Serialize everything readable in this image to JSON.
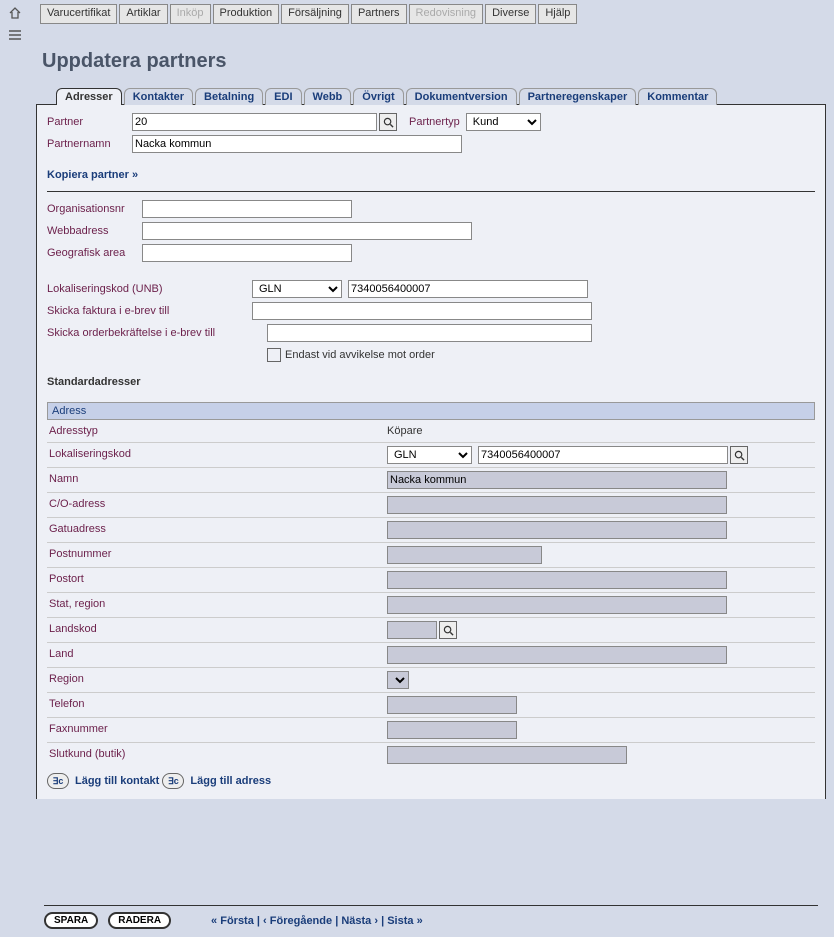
{
  "top_tabs": [
    {
      "label": "Varucertifikat",
      "disabled": false
    },
    {
      "label": "Artiklar",
      "disabled": false
    },
    {
      "label": "Inköp",
      "disabled": true
    },
    {
      "label": "Produktion",
      "disabled": false
    },
    {
      "label": "Försäljning",
      "disabled": false
    },
    {
      "label": "Partners",
      "disabled": false
    },
    {
      "label": "Redovisning",
      "disabled": true
    },
    {
      "label": "Diverse",
      "disabled": false
    },
    {
      "label": "Hjälp",
      "disabled": false
    }
  ],
  "page_title": "Uppdatera partners",
  "sub_tabs": [
    "Adresser",
    "Kontakter",
    "Betalning",
    "EDI",
    "Webb",
    "Övrigt",
    "Dokumentversion",
    "Partneregenskaper",
    "Kommentar"
  ],
  "active_sub_tab": 0,
  "header": {
    "partner_label": "Partner",
    "partner_value": "20",
    "partnertyp_label": "Partnertyp",
    "partnertyp_value": "Kund",
    "partnernamn_label": "Partnernamn",
    "partnernamn_value": "Nacka kommun",
    "kopiera_link": "Kopiera partner »"
  },
  "org_block": {
    "organisationsnr_label": "Organisationsnr",
    "organisationsnr_value": "",
    "webbadress_label": "Webbadress",
    "webbadress_value": "",
    "geo_label": "Geografisk area",
    "geo_value": ""
  },
  "loc_block": {
    "lokaliseringskod_label": "Lokaliseringskod (UNB)",
    "lokaliseringskod_type": "GLN",
    "lokaliseringskod_value": "7340056400007",
    "skicka_faktura_label": "Skicka faktura i e-brev till",
    "skicka_faktura_value": "",
    "skicka_order_label": "Skicka orderbekräftelse i e-brev till",
    "skicka_order_value": "",
    "endast_label": "Endast vid avvikelse mot order"
  },
  "section_heading": "Standardadresser",
  "address": {
    "panel_title": "Adress",
    "rows": {
      "adresstyp_label": "Adresstyp",
      "adresstyp_value": "Köpare",
      "lokaliseringskod_label": "Lokaliseringskod",
      "lokaliseringskod_type": "GLN",
      "lokaliseringskod_value": "7340056400007",
      "namn_label": "Namn",
      "namn_value": "Nacka kommun",
      "co_label": "C/O-adress",
      "co_value": "",
      "gatu_label": "Gatuadress",
      "gatu_value": "",
      "postnr_label": "Postnummer",
      "postnr_value": "",
      "postort_label": "Postort",
      "postort_value": "",
      "stat_label": "Stat, region",
      "stat_value": "",
      "landskod_label": "Landskod",
      "landskod_value": "",
      "land_label": "Land",
      "land_value": "",
      "region_label": "Region",
      "region_value": "",
      "telefon_label": "Telefon",
      "telefon_value": "",
      "fax_label": "Faxnummer",
      "fax_value": "",
      "slutkund_label": "Slutkund (butik)",
      "slutkund_value": ""
    },
    "add_contact_label": "Lägg till kontakt",
    "add_address_label": "Lägg till adress"
  },
  "footer": {
    "spara": "SPARA",
    "radera": "RADERA",
    "forsta": "« Första",
    "foregaende": "‹ Föregående",
    "nasta": "Nästa ›",
    "sista": "Sista »",
    "sep": " | "
  }
}
